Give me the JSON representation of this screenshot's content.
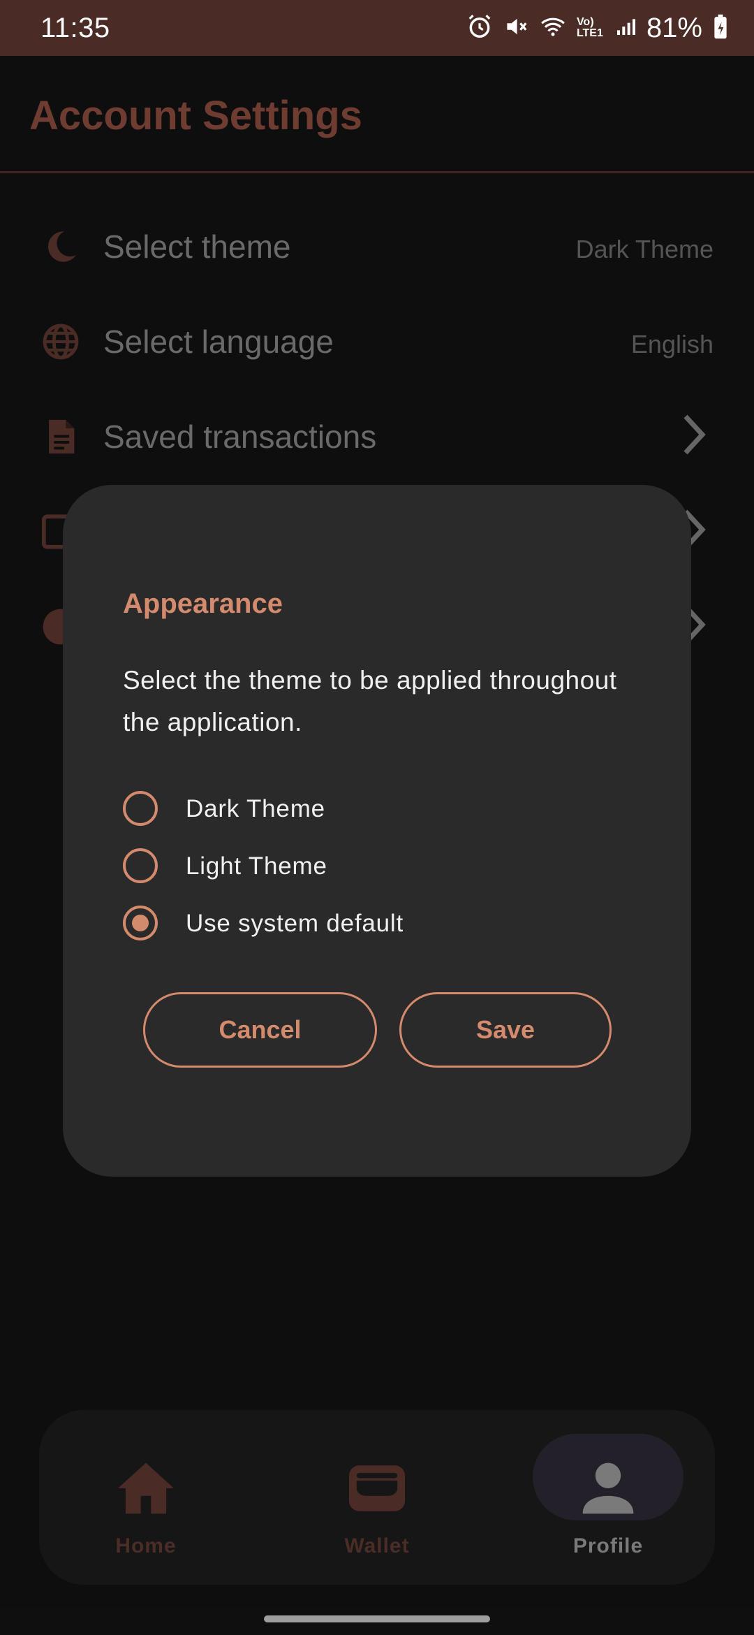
{
  "status_bar": {
    "time": "11:35",
    "battery": "81%",
    "network_label": "Vo) LTE1",
    "icons": [
      "alarm-icon",
      "mute-icon",
      "wifi-icon",
      "signal-icon",
      "battery-icon"
    ]
  },
  "header": {
    "title": "Account Settings"
  },
  "settings": {
    "items": [
      {
        "label": "Select theme",
        "value": "Dark Theme",
        "icon": "moon-icon"
      },
      {
        "label": "Select language",
        "value": "English",
        "icon": "globe-icon"
      },
      {
        "label": "Saved transactions",
        "value": "",
        "icon": "document-icon"
      }
    ]
  },
  "dialog": {
    "title": "Appearance",
    "message": "Select the theme to be applied throughout the application.",
    "options": [
      {
        "label": "Dark Theme",
        "checked": false
      },
      {
        "label": "Light Theme",
        "checked": false
      },
      {
        "label": "Use system default",
        "checked": true
      }
    ],
    "cancel_label": "Cancel",
    "save_label": "Save"
  },
  "bottom_nav": {
    "items": [
      {
        "label": "Home",
        "icon": "home-icon",
        "active": false
      },
      {
        "label": "Wallet",
        "icon": "wallet-icon",
        "active": false
      },
      {
        "label": "Profile",
        "icon": "person-icon",
        "active": true
      }
    ]
  },
  "colors": {
    "accent": "#d48a6c",
    "status_bar": "#4a2b26",
    "dialog_bg": "#2a2a2a",
    "background": "#0e0e0e"
  }
}
